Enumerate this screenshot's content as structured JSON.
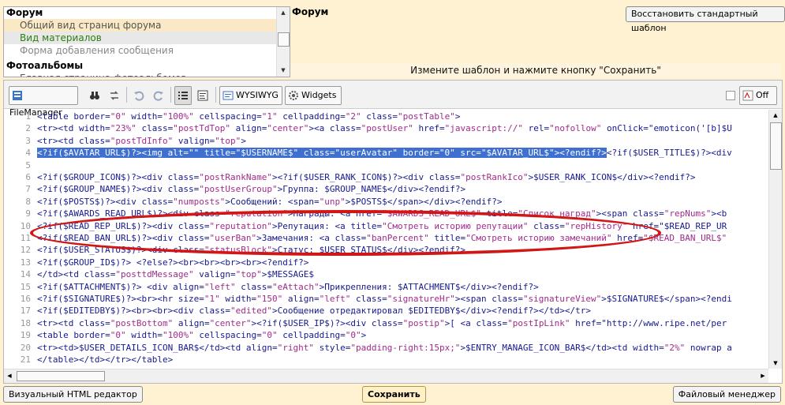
{
  "tree": {
    "sections": [
      {
        "title": "Форум",
        "items": [
          {
            "label": "Общий вид страниц форума",
            "state": "hl"
          },
          {
            "label": "Вид материалов",
            "state": "active"
          },
          {
            "label": "Форма добавления сообщения",
            "state": "dim"
          }
        ]
      },
      {
        "title": "Фотоальбомы",
        "items": [
          {
            "label": "Главная страница фотоальбомов",
            "state": ""
          }
        ]
      }
    ]
  },
  "info": {
    "title": "Форум",
    "restore_label": "Восстановить стандартный шаблон",
    "hint": "Измените шаблон и нажмите кнопку \"Сохранить\""
  },
  "toolbar": {
    "filemanager_label": "FileManager",
    "wysiwyg_label": "WYSIWYG",
    "widgets_label": "Widgets",
    "off_label": "Off"
  },
  "code_lines": [
    "<table border=\"0\" width=\"100%\" cellspacing=\"1\" cellpadding=\"2\" class=\"postTable\">",
    "<tr><td width=\"23%\" class=\"postTdTop\" align=\"center\"><a class=\"postUser\" href=\"javascript://\" rel=\"nofollow\" onClick=\"emoticon('[b]$U",
    "<tr><td class=\"postTdInfo\" valign=\"top\">",
    "<?if($AVATAR_URL$)?><img alt=\"\" title=\"$USERNAME$\" class=\"userAvatar\" border=\"0\" src=\"$AVATAR_URL$\"><?endif?><?if($USER_TITLE$)?><div",
    "",
    "<?if($GROUP_ICON$)?><div class=\"postRankName\"><?if($USER_RANK_ICON$)?><div class=\"postRankIco\">$USER_RANK_ICON$</div><?endif?>",
    "<?if($GROUP_NAME$)?><div class=\"postUserGroup\">Группа: $GROUP_NAME$</div><?endif?>",
    "<?if($POSTS$)?><div class=\"numposts\">Сообщений: <span=\"unp\">$POSTS$</span></div><?endif?>",
    "<?if($AWARDS_READ_URL$)?><div class=\"reputation\">Награды: <a href=\"$AWARDS_READ_URL$\" title=\"Список наград\"><span class=\"repNums\"><b",
    "<?if($READ_REP_URL$)?><div class=\"reputation\">Репутация: <a title=\"Смотреть историю репутации\" class=\"repHistory\" href=\"$READ_REP_UR",
    "<?if($READ_BAN_URL$)?><div class=\"userBan\">Замечания: <a class=\"banPercent\" title=\"Смотреть историю замечаний\" href=\"$READ_BAN_URL$\"",
    "<?if($USER_STATUS$)?><div class=\"statusBlock\">Статус: $USER_STATUS$</div><?endif?>",
    "<?if($GROUP_ID$)?> <?else?><br><br><br><br><?endif?>",
    "</td><td class=\"posttdMessage\" valign=\"top\">$MESSAGE$",
    "<?if($ATTACHMENT$)?> <div align=\"left\" class=\"eAttach\">Прикрепления: $ATTACHMENT$</div><?endif?>",
    "<?if($SIGNATURE$)?><br><hr size=\"1\" width=\"150\" align=\"left\" class=\"signatureHr\"><span class=\"signatureView\">$SIGNATURE$</span><?endi",
    "<?if($EDITEDBY$)?><br><br><div class=\"edited\">Сообщение отредактировал $EDITEDBY$</div><?endif?></td></tr>",
    "<tr><td class=\"postBottom\" align=\"center\"><?if($USER_IP$)?><div class=\"postip\">[ <a class=\"postIpLink\" href=\"http://www.ripe.net/per",
    "<table border=\"0\" width=\"100%\" cellspacing=\"0\" cellpadding=\"0\">",
    "<tr><td>$USER_DETAILS_ICON_BAR$</td><td align=\"right\" style=\"padding-right:15px;\">$ENTRY_MANAGE_ICON_BAR$</td><td width=\"2%\" nowrap a",
    "</table></td></tr></table>"
  ],
  "selection": {
    "line": 4,
    "text": "<?if($AVATAR_URL$)?><img alt=\"\" title=\"$USERNAME$\" class=\"userAvatar\" border=\"0\" src=\"$AVATAR_URL$\"><?endif?>"
  },
  "bottom": {
    "visual_label": "Визуальный HTML редактор",
    "save_label": "Сохранить",
    "filemanager_label": "Файловый менеджер"
  },
  "colors": {
    "selection": "#3f6fd0",
    "annotation": "#d21515",
    "tag": "#16198f",
    "string": "#a12b8a"
  }
}
